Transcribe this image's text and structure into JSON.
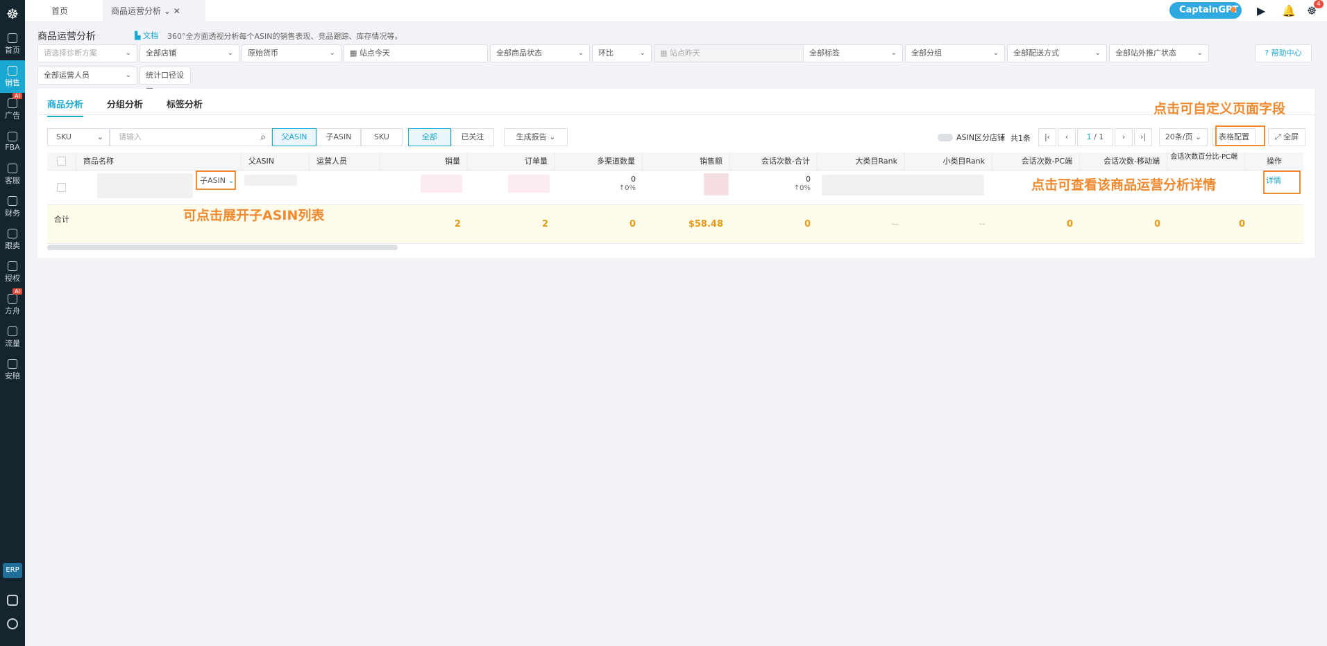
{
  "sidebar": {
    "items": [
      {
        "label": "首页",
        "icon": "home-icon"
      },
      {
        "label": "销售",
        "icon": "chart-icon"
      },
      {
        "label": "广告",
        "icon": "ad-icon",
        "ai": "AI"
      },
      {
        "label": "FBA",
        "icon": "box-icon"
      },
      {
        "label": "客服",
        "icon": "chat-icon"
      },
      {
        "label": "财务",
        "icon": "money-icon"
      },
      {
        "label": "跟卖",
        "icon": "pie-icon"
      },
      {
        "label": "授权",
        "icon": "shield-icon"
      },
      {
        "label": "方舟",
        "icon": "ark-icon",
        "ai": "AI"
      },
      {
        "label": "流量",
        "icon": "traffic-icon"
      },
      {
        "label": "安賠",
        "icon": "refund-icon"
      }
    ],
    "erp": "ERP"
  },
  "tabs": [
    {
      "label": "首页"
    },
    {
      "label": "商品运营分析"
    }
  ],
  "gpt": "CaptainGPT",
  "notif_count": "4",
  "page": {
    "title": "商品运营分析",
    "doc": "文档",
    "desc": "360°全方面透视分析每个ASIN的销售表现、竞品跟踪、库存情况等。"
  },
  "filters": {
    "scheme": "请选择诊断方案",
    "shop": "全部店铺",
    "currency": "原始货币",
    "date": "站点今天",
    "status": "全部商品状态",
    "compare": "环比",
    "compare_date": "站点昨天",
    "tag": "全部标签",
    "group": "全部分组",
    "delivery": "全部配送方式",
    "promo": "全部站外推广状态",
    "operator": "全部运营人员",
    "stats": "统计口径设置",
    "help": "帮助中心"
  },
  "subtabs": [
    "商品分析",
    "分组分析",
    "标签分析"
  ],
  "toolbar": {
    "search_type": "SKU",
    "search_ph": "请输入",
    "parent": "父ASIN",
    "child": "子ASIN",
    "sku": "SKU",
    "all": "全部",
    "followed": "已关注",
    "report": "生成报告",
    "asin_shop": "ASIN区分店铺",
    "total": "共1条",
    "page_cur": "1",
    "page_total": "/ 1",
    "page_size": "20条/页",
    "config": "表格配置",
    "fullscreen": "全屏"
  },
  "columns": [
    "商品名称",
    "父ASIN",
    "运营人员",
    "销量",
    "订单量",
    "多渠道数量",
    "销售额",
    "会话次数-合计",
    "大类目Rank",
    "小类目Rank",
    "会话次数-PC端",
    "会话次数-移动端",
    "会话次数百分比-PC端",
    "操作"
  ],
  "row": {
    "child_asin": "子ASIN",
    "multi": "0",
    "multi_pct": "↑0%",
    "sessions": "0",
    "sessions_pct": "↑0%",
    "detail": "详情"
  },
  "summary": {
    "label": "合计",
    "sales": "2",
    "orders": "2",
    "multi": "0",
    "amount": "$58.48",
    "sessions": "0",
    "rank_big": "--",
    "rank_small": "--",
    "pc": "0",
    "mobile": "0",
    "pct": "0"
  },
  "annotations": {
    "config": "点击可自定义页面字段",
    "detail": "点击可查看该商品运营分析详情",
    "expand": "可点击展开子ASIN列表"
  }
}
